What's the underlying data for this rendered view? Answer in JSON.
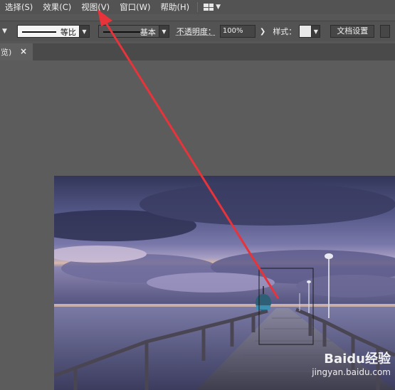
{
  "menubar": {
    "items": [
      "选择(S)",
      "效果(C)",
      "视图(V)",
      "窗口(W)",
      "帮助(H)"
    ]
  },
  "toolbar": {
    "stroke_style_1": "等比",
    "stroke_style_2": "基本",
    "opacity_label": "不透明度：",
    "opacity_value": "100%",
    "style_label": "样式：",
    "doc_settings": "文档设置"
  },
  "tabs": {
    "doc_tab_label": "览)",
    "close_glyph": "×"
  },
  "canvas": {
    "selection": "rectangle",
    "annotation": "red arrow pointing to 视图(V) menu"
  },
  "watermark": {
    "logo_text": "Baidu经验",
    "url": "jingyan.baidu.com"
  },
  "colors": {
    "ui_bg": "#535353",
    "arrow": "#e8333a",
    "sky_top": "#3d3f66",
    "sky_mid": "#8a87b6",
    "horizon": "#d9b7a6",
    "sea": "#5b5d88",
    "pier": "#4a4a58"
  }
}
